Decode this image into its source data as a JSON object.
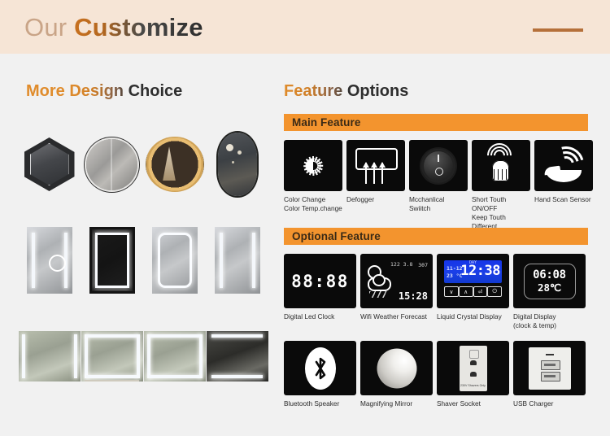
{
  "header": {
    "title_light": "Our ",
    "title_bold": "Customize",
    "rule": "header-rule"
  },
  "left": {
    "title_accent": "More ",
    "title_mid": "Design ",
    "title_dark": "Choice",
    "rows": [
      {
        "items": [
          {
            "name": "hexagon-led-mirror"
          },
          {
            "name": "round-led-mirror"
          },
          {
            "name": "round-gold-backlit-mirror"
          },
          {
            "name": "oval-capsule-led-mirror"
          }
        ]
      },
      {
        "items": [
          {
            "name": "vertical-led-mirror-with-magnifier"
          },
          {
            "name": "black-frame-vertical-led-mirror"
          },
          {
            "name": "rounded-corner-vertical-led-mirror"
          },
          {
            "name": "vertical-side-strip-led-mirror"
          }
        ]
      },
      {
        "items": [
          {
            "name": "landscape-side-strip-led-mirror"
          },
          {
            "name": "landscape-full-ring-led-mirror"
          },
          {
            "name": "landscape-wide-ring-led-mirror"
          },
          {
            "name": "landscape-top-bottom-led-mirror"
          }
        ]
      }
    ]
  },
  "right": {
    "title_accent": "Feature ",
    "title_dark": "Options",
    "main_bar": "Main Feature",
    "optional_bar": "Optional Feature",
    "main_features": [
      {
        "icon": "color-change-sun-icon",
        "label": "Color Change\nColor Temp.change"
      },
      {
        "icon": "defogger-icon",
        "label": "Defogger"
      },
      {
        "icon": "mechanical-switch-knob-icon",
        "label": "Mcchanlical\nSwiitch"
      },
      {
        "icon": "touch-sensor-icon",
        "label": "Short Touth ON/OFF\nKeep Touth Different\nFunction"
      },
      {
        "icon": "hand-scan-sensor-icon",
        "label": "Hand Scan Sensor"
      }
    ],
    "optional_features_row1": [
      {
        "icon": "digital-led-clock-icon",
        "label": "Digital Led Clock",
        "display": "88:88"
      },
      {
        "icon": "wifi-weather-forecast-icon",
        "label": "Wifi Weather Forecast",
        "display": "15:28"
      },
      {
        "icon": "liquid-crystal-display-icon",
        "label": "Liquid Crystal Display",
        "display": "12:38",
        "sub_date": "11-12",
        "sub_temp": "23 °C",
        "tiny": "DAY"
      },
      {
        "icon": "digital-display-icon",
        "label": "Digital Display\n(clock & temp)",
        "display": "06:08",
        "temp": "28℃"
      }
    ],
    "optional_features_row2": [
      {
        "icon": "bluetooth-speaker-icon",
        "label": "Bluetooth Speaker"
      },
      {
        "icon": "magnifying-mirror-icon",
        "label": "Magnifying Mirror"
      },
      {
        "icon": "shaver-socket-icon",
        "label": "Shaver Socket",
        "caption": "230V\nShavers Only"
      },
      {
        "icon": "usb-charger-icon",
        "label": "USB Charger"
      }
    ],
    "lcd_buttons": [
      "∨",
      "∧",
      "⏎",
      "⏻"
    ],
    "weather_small": {
      "col_a": "122  3.8",
      "col_b": "307",
      "col_c": "15:28"
    }
  },
  "colors": {
    "header_bg": "#f6e5d6",
    "page_bg": "#f1f1f1",
    "accent_orange": "#e08c2c",
    "bar_orange": "#f3942e",
    "rule_brown": "#b5703a",
    "tile_black": "#0a0a0a",
    "lcd_blue": "#1636e8"
  }
}
